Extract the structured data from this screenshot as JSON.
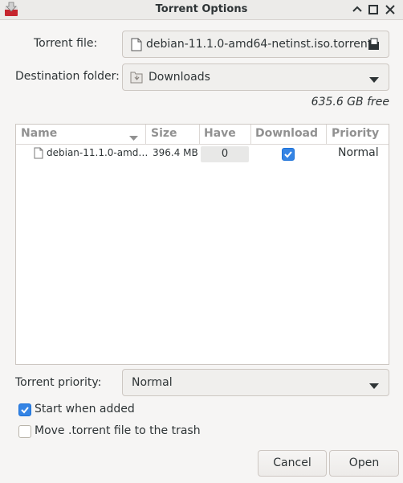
{
  "window": {
    "title": "Torrent Options",
    "controls": [
      "minimize-icon",
      "maximize-icon",
      "close-icon"
    ]
  },
  "torrent_file": {
    "label": "Torrent file:",
    "value": "debian-11.1.0-amd64-netinst.iso.torrent",
    "icons": [
      "file-icon",
      "open-file-icon"
    ]
  },
  "destination": {
    "label": "Destination folder:",
    "value": "Downloads",
    "icons": [
      "folder-icon",
      "chevron-down-icon"
    ],
    "free_space": "635.6 GB free"
  },
  "file_list": {
    "columns": [
      "Name",
      "Size",
      "Have",
      "Download",
      "Priority"
    ],
    "rows": [
      {
        "name": "debian-11.1.0-amd…",
        "size": "396.4 MB",
        "have": "0",
        "download": true,
        "priority": "Normal"
      }
    ]
  },
  "torrent_priority": {
    "label": "Torrent priority:",
    "value": "Normal"
  },
  "options": {
    "start_when_added": {
      "label": "Start when added",
      "checked": true
    },
    "move_to_trash": {
      "label": "Move .torrent file to the trash",
      "checked": false
    }
  },
  "buttons": {
    "cancel": "Cancel",
    "open": "Open"
  },
  "colors": {
    "accent": "#3584e4",
    "background": "#f6f5f4",
    "app_icon_red": "#c6262e"
  }
}
